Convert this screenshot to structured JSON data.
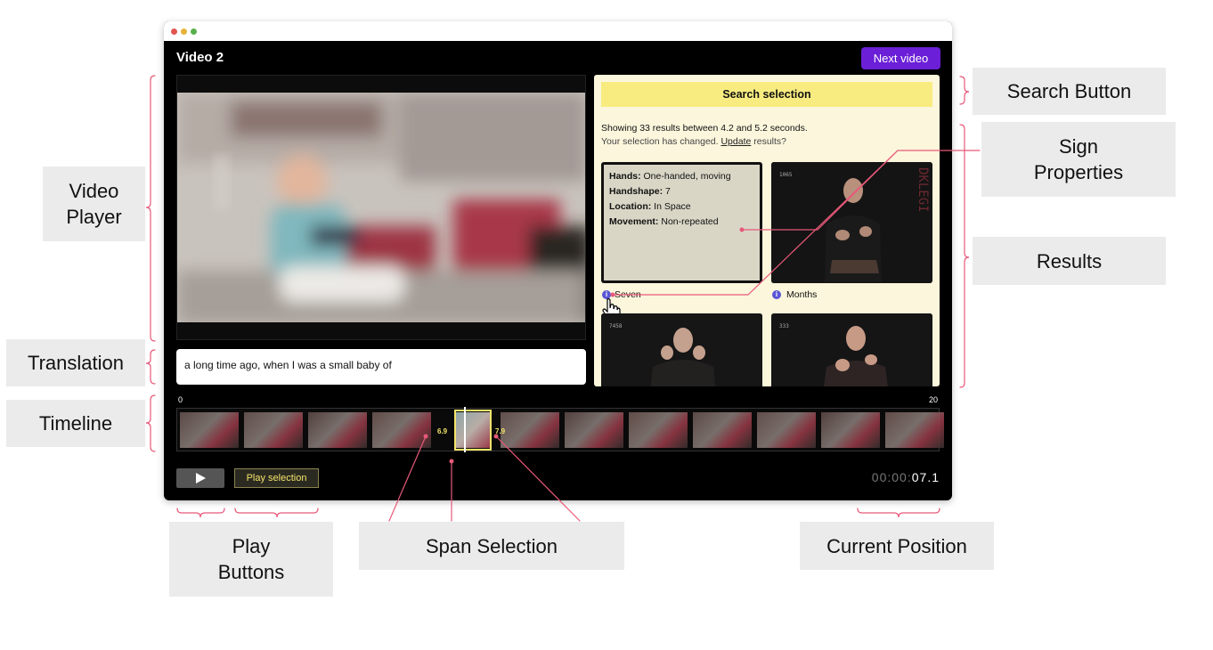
{
  "window": {
    "dots": [
      "#e2564f",
      "#e6b23a",
      "#5ab04c"
    ]
  },
  "header": {
    "title": "Video 2",
    "next_label": "Next video",
    "next_color": "#6b1fd6"
  },
  "translation": {
    "text": "a long time ago, when I was a small baby of"
  },
  "search": {
    "button_label": "Search selection",
    "button_color": "#f8ec80",
    "panel_color": "#fbf6dc",
    "summary": "Showing 33 results between 4.2 and 5.2 seconds.",
    "changed_prefix": "Your selection has changed.",
    "update_link": "Update",
    "changed_suffix": "results?"
  },
  "results": {
    "properties": [
      {
        "key": "Hands:",
        "value": "One-handed, moving"
      },
      {
        "key": "Handshape:",
        "value": "7"
      },
      {
        "key": "Location:",
        "value": "In Space"
      },
      {
        "key": "Movement:",
        "value": "Non-repeated"
      }
    ],
    "labels": [
      "Seven",
      "Months"
    ],
    "info_icon": "i",
    "frame_numbers": [
      "1065",
      "7458",
      "333"
    ]
  },
  "timeline": {
    "start": "0",
    "end": "20",
    "selection_start": "6.9",
    "selection_end": "7.9",
    "selection_color": "#f4e46a"
  },
  "controls": {
    "play_icon": "play-icon",
    "play_selection_label": "Play selection"
  },
  "clock": {
    "dim": "00:00:",
    "bright": "07",
    "frac": ".1"
  },
  "annotations": {
    "color": "#e8597a",
    "video_player": "Video\nPlayer",
    "translation": "Translation",
    "timeline": "Timeline",
    "search_button": "Search Button",
    "sign_properties": "Sign\nProperties",
    "results": "Results",
    "play_buttons": "Play\nButtons",
    "span_selection": "Span Selection",
    "current_position": "Current Position"
  }
}
